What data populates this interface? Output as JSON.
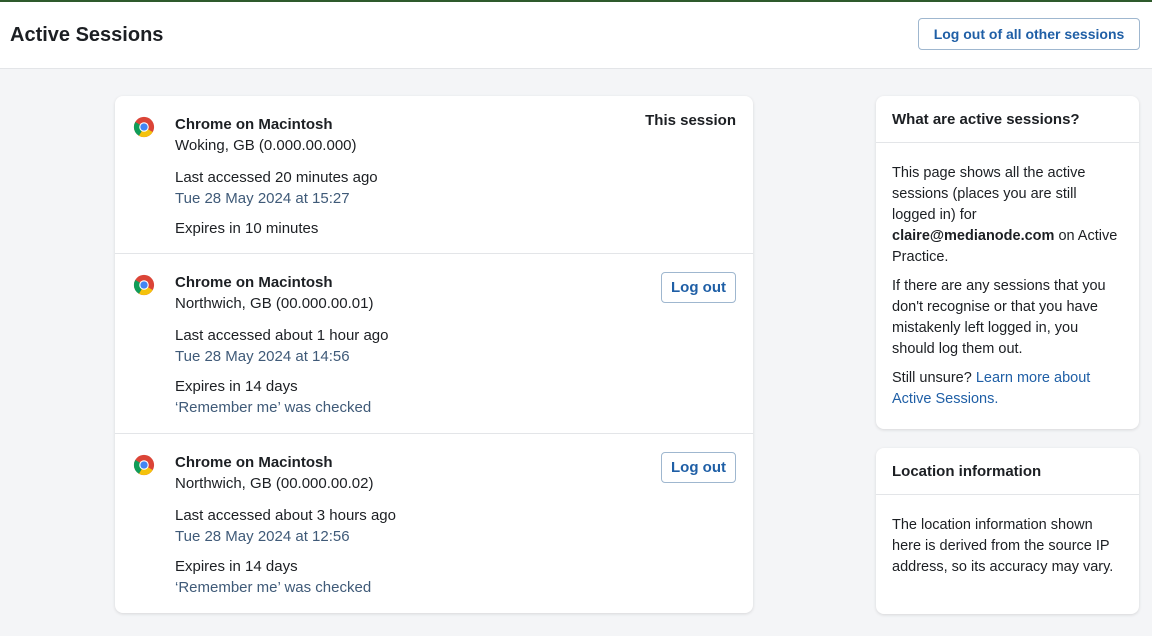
{
  "header": {
    "title": "Active Sessions",
    "logout_all_label": "Log out of all other sessions"
  },
  "sessions": [
    {
      "browser": "Chrome on Macintosh",
      "location": "Woking, GB (0.000.00.000)",
      "last_accessed": "Last accessed 20 minutes ago",
      "date": "Tue 28 May 2024 at 15:27",
      "expires": "Expires in 10 minutes",
      "remember": "",
      "status": "This session"
    },
    {
      "browser": "Chrome on Macintosh",
      "location": "Northwich, GB (00.000.00.01)",
      "last_accessed": "Last accessed about 1 hour ago",
      "date": "Tue 28 May 2024 at 14:56",
      "expires": "Expires in 14 days",
      "remember": "‘Remember me’ was checked",
      "logout_label": "Log out"
    },
    {
      "browser": "Chrome on Macintosh",
      "location": "Northwich, GB (00.000.00.02)",
      "last_accessed": "Last accessed about 3 hours ago",
      "date": "Tue 28 May 2024 at 12:56",
      "expires": "Expires in 14 days",
      "remember": "‘Remember me’ was checked",
      "logout_label": "Log out"
    }
  ],
  "sidebar": {
    "what": {
      "heading": "What are active sessions?",
      "p1_text": "This page shows all the active sessions (places you are still logged in) for",
      "p1_email": "claire@medianode.com",
      "p1_suffix": "on Active Practice.",
      "p2": "If there are any sessions that you don't recognise or that you have mistakenly left logged in, you should log them out.",
      "p3_text": "Still unsure?",
      "p3_link": "Learn more about Active Sessions."
    },
    "location": {
      "heading": "Location information",
      "body": "The location information shown here is derived from the source IP address, so its accuracy may vary."
    }
  },
  "icons": {
    "browser": "chrome-icon"
  },
  "colors": {
    "accent": "#1f5fa6",
    "muted_text": "#3f5a78",
    "top_line": "#2e5a2c"
  }
}
